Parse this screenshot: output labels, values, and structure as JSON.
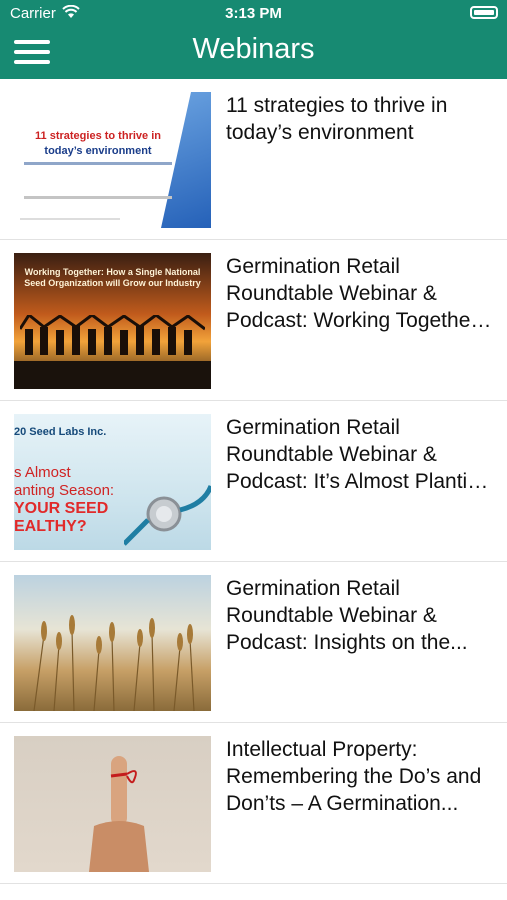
{
  "status_bar": {
    "carrier": "Carrier",
    "time": "3:13 PM"
  },
  "header": {
    "title": "Webinars",
    "menu_icon": "hamburger-menu-icon"
  },
  "colors": {
    "header_bg": "#178a72",
    "header_text": "#ffffff",
    "divider": "#e2e2e2"
  },
  "webinars": [
    {
      "title": "11 strategies to thrive in today’s environment",
      "thumb": {
        "line1": "11 strategies to thrive in",
        "line2": "today’s environment"
      }
    },
    {
      "title": "Germination Retail Roundtable Webinar & Podcast: Working Together: How a Single National Seed Organization will Grow our Industry",
      "thumb": {
        "banner": "Working Together: How a Single National Seed Organization will Grow our Industry"
      }
    },
    {
      "title": "Germination Retail Roundtable Webinar & Podcast: It’s Almost Planting Season: Is Your Seed Healthy?",
      "thumb": {
        "logo": "20 Seed Labs Inc.",
        "line1": "s Almost",
        "line2": "anting Season:",
        "line3": "YOUR SEED",
        "line4": "EALTHY?"
      }
    },
    {
      "title": "Germination Retail Roundtable Webinar & Podcast: Insights on the...",
      "thumb": {}
    },
    {
      "title": "Intellectual Property: Remembering the Do’s and Don’ts – A Germination...",
      "thumb": {}
    }
  ]
}
